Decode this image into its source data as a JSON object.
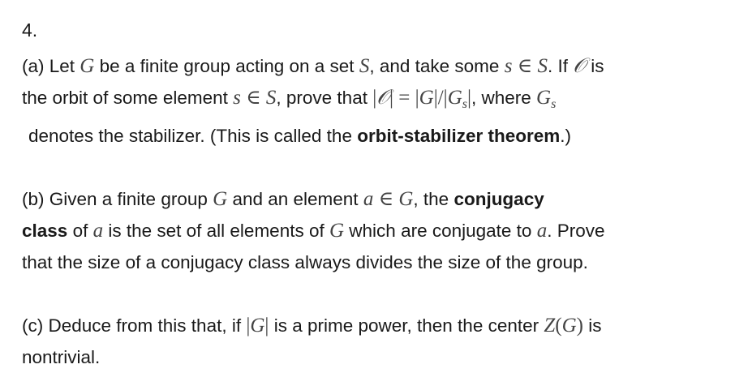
{
  "problem": {
    "number": "4.",
    "part_a": {
      "l1_t1": "(a) Let ",
      "G": "G",
      "l1_t2": " be a finite group acting on a set ",
      "S": "S",
      "l1_t3": ", and take some ",
      "s": "s",
      "in": " ∈ ",
      "l1_t4": ". If ",
      "O": "𝒪",
      "l1_t5": " is",
      "l2_t1": "the orbit of some element ",
      "l2_t2": ", prove that ",
      "bar": "|",
      "eq": " = ",
      "slash": "/",
      "l2_t3": ", where ",
      "sub_s": "s",
      "l3_t1": "denotes the stabilizer. (This is called the ",
      "bold_term": "orbit-stabilizer theorem",
      "l3_t2": ".)"
    },
    "part_b": {
      "l1_t1": "(b) Given a finite group ",
      "l1_t2": " and an element ",
      "a": "a",
      "l1_t3": ", the ",
      "bold1": "conjugacy",
      "bold2": "class",
      "l2_t1": " of ",
      "l2_t2": " is the set of all elements of ",
      "l2_t3": " which are conjugate to ",
      "l2_t4": ". Prove",
      "l3": "that the size of a conjugacy class always divides the size of the group."
    },
    "part_c": {
      "l1_t1": "(c) Deduce from this that, if ",
      "l1_t2": " is a prime power, then the center ",
      "Z": "Z",
      "lp": "(",
      "rp": ")",
      "l1_t3": " is",
      "l2": "nontrivial."
    }
  }
}
